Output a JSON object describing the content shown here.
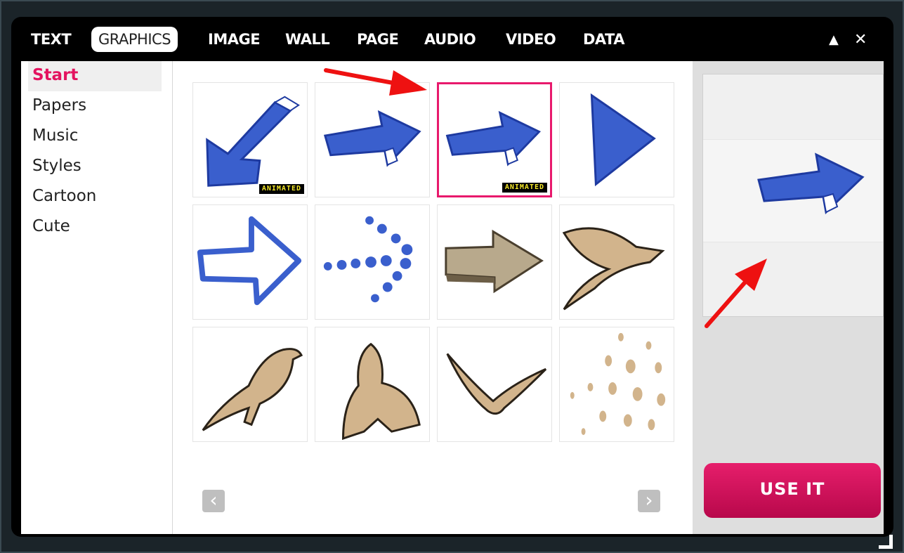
{
  "tabs": [
    {
      "label": "TEXT",
      "active": false
    },
    {
      "label": "GRAPHICS",
      "active": true
    },
    {
      "label": "IMAGE",
      "active": false
    },
    {
      "label": "WALL",
      "active": false
    },
    {
      "label": "PAGE",
      "active": false
    },
    {
      "label": "AUDIO",
      "active": false
    },
    {
      "label": "VIDEO",
      "active": false
    },
    {
      "label": "DATA",
      "active": false
    }
  ],
  "window_controls": {
    "collapse": "▲",
    "close": "✕"
  },
  "sidebar": {
    "items": [
      {
        "label": "Start",
        "active": true
      },
      {
        "label": "Papers"
      },
      {
        "label": "Music"
      },
      {
        "label": "Styles"
      },
      {
        "label": "Cartoon"
      },
      {
        "label": "Cute"
      }
    ]
  },
  "grid": {
    "items": [
      {
        "icon": "arrow-down-left-icon",
        "badge": "ANIMATED",
        "selected": false
      },
      {
        "icon": "arrow-right-icon",
        "badge": "",
        "selected": false
      },
      {
        "icon": "arrow-right-icon",
        "badge": "ANIMATED",
        "selected": true
      },
      {
        "icon": "triangle-play-icon",
        "badge": "",
        "selected": false
      },
      {
        "icon": "outline-arrow-right-icon",
        "badge": "",
        "selected": false
      },
      {
        "icon": "dotted-arrow-right-icon",
        "badge": "",
        "selected": false
      },
      {
        "icon": "3d-arrow-right-icon",
        "badge": "",
        "selected": false
      },
      {
        "icon": "bird-flying-icon",
        "badge": "",
        "selected": false
      },
      {
        "icon": "bird-perched-icon",
        "badge": "",
        "selected": false
      },
      {
        "icon": "bird-rising-icon",
        "badge": "",
        "selected": false
      },
      {
        "icon": "bird-gliding-icon",
        "badge": "",
        "selected": false
      },
      {
        "icon": "raindrops-icon",
        "badge": "",
        "selected": false
      }
    ]
  },
  "pager": {
    "prev": "‹",
    "next": "›"
  },
  "preview": {
    "icon": "arrow-right-icon"
  },
  "use_button": {
    "label": "USE IT"
  },
  "colors": {
    "accent": "#e8196c",
    "blue_sketch": "#3a5fcd",
    "paper_tan": "#d2b48c",
    "annotation_red": "#ee1111"
  }
}
